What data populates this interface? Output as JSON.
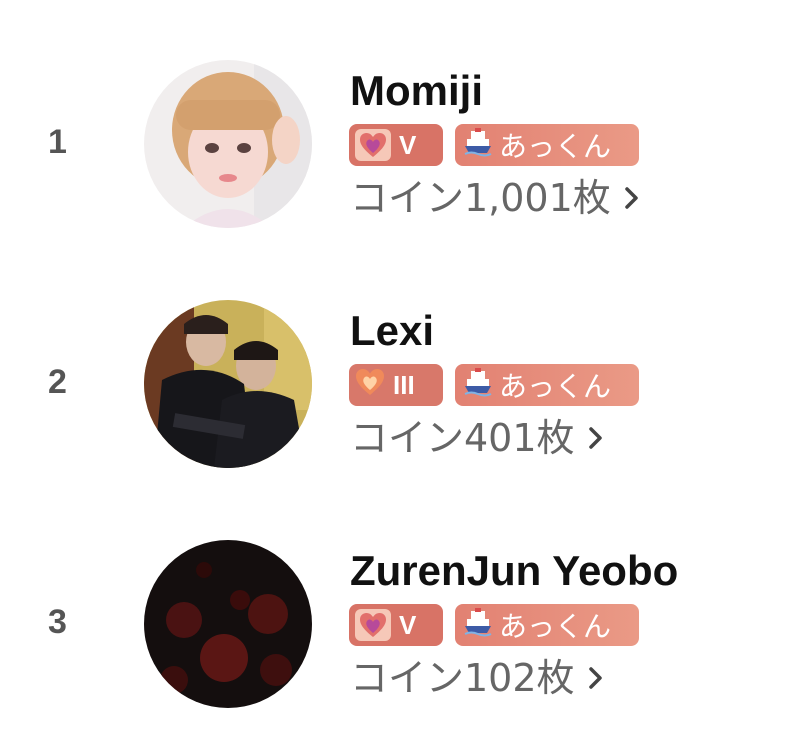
{
  "colors": {
    "badge_bg": "#d87366",
    "name_text": "#111111",
    "coin_text": "#666666",
    "rank_text": "#555555"
  },
  "leaderboard": [
    {
      "rank": "1",
      "name": "Momiji",
      "level_badge": "V",
      "level_icon": "heart-icon",
      "fan_badge": "あっくん",
      "fan_icon": "ship-icon",
      "coins": "コイン1,001枚",
      "avatar": "avatar-photo-blonde-girl"
    },
    {
      "rank": "2",
      "name": "Lexi",
      "level_badge": "III",
      "level_icon": "heart-icon",
      "fan_badge": "あっくん",
      "fan_icon": "ship-icon",
      "coins": "コイン401枚",
      "avatar": "avatar-photo-two-men"
    },
    {
      "rank": "3",
      "name": "ZurenJun Yeobo",
      "level_badge": "V",
      "level_icon": "heart-icon",
      "fan_badge": "あっくん",
      "fan_icon": "ship-icon",
      "coins": "コイン102枚",
      "avatar": "avatar-photo-red-flowers"
    }
  ]
}
